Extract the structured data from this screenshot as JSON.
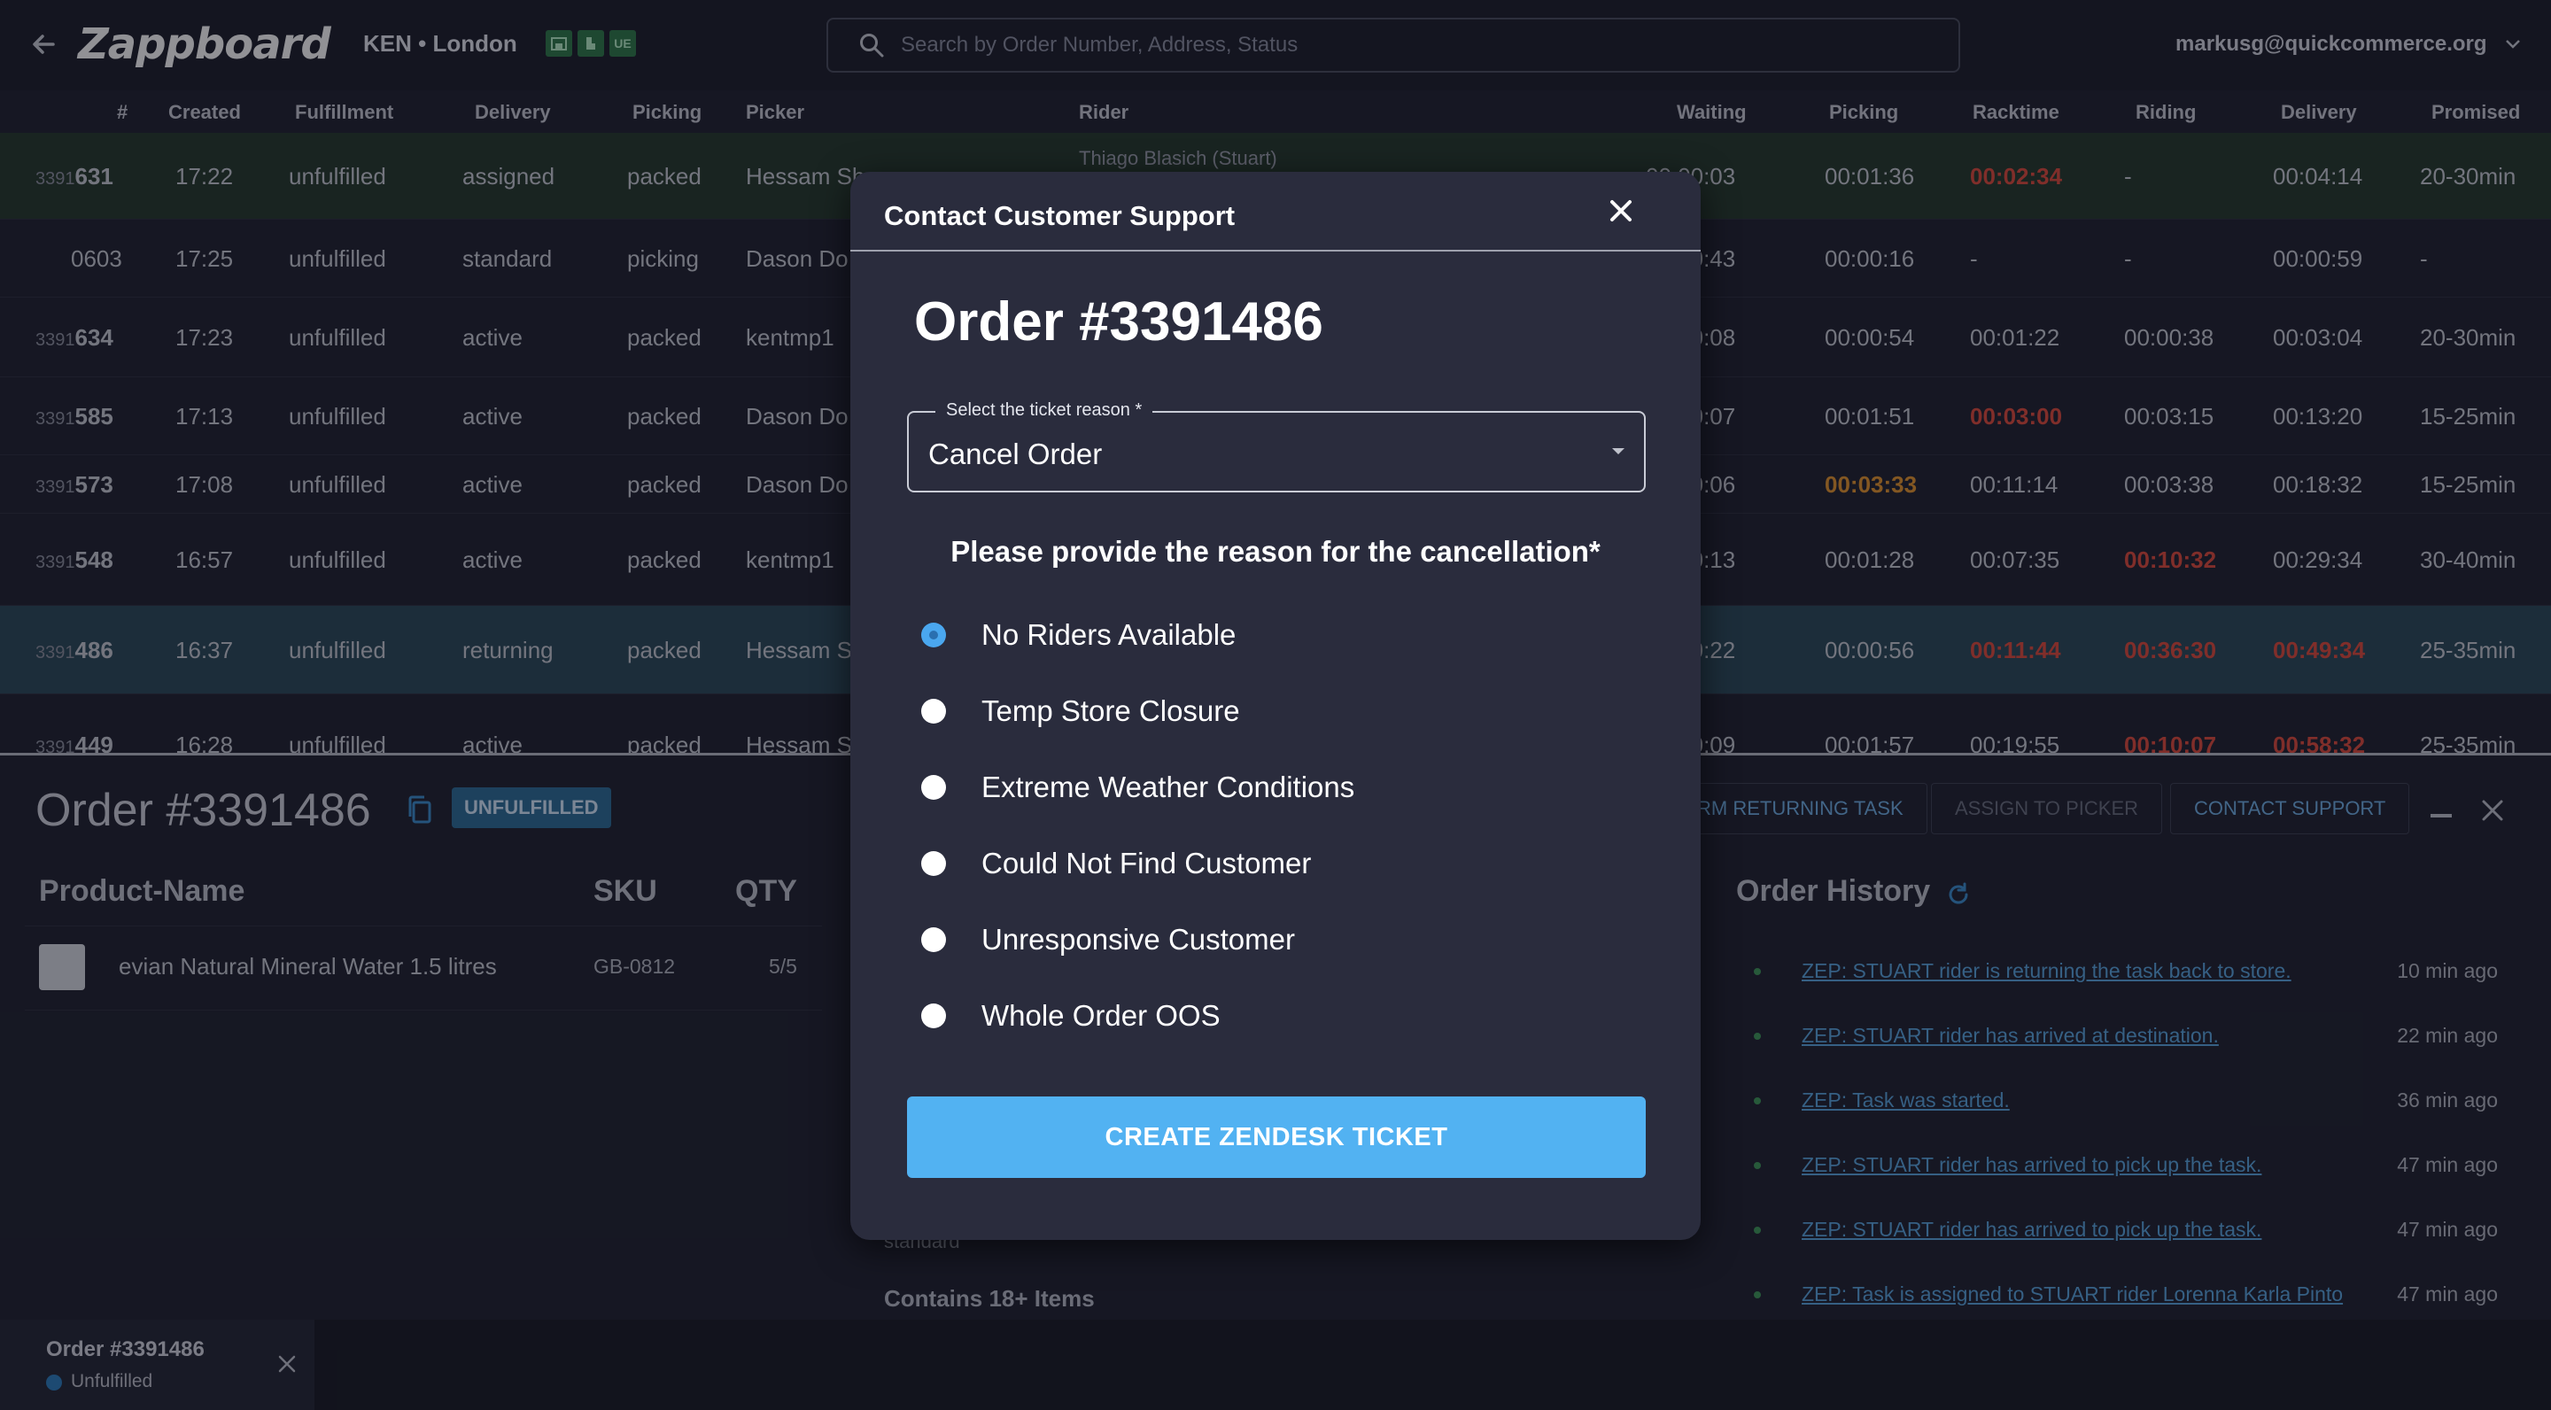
{
  "topbar": {
    "logo": "Zappboard",
    "store": "KEN • London",
    "badges": [
      "",
      "",
      "UE"
    ],
    "search_placeholder": "Search by Order Number, Address, Status",
    "user_email": "markusg@quickcommerce.org"
  },
  "table": {
    "headers": {
      "num": "#",
      "created": "Created",
      "fulfillment": "Fulfillment",
      "delivery": "Delivery",
      "picking": "Picking",
      "picker": "Picker",
      "rider": "Rider",
      "waiting": "Waiting",
      "picking_time": "Picking",
      "racktime": "Racktime",
      "riding": "Riding",
      "delivery_time": "Delivery",
      "promised": "Promised"
    },
    "rows": [
      {
        "prefix": "3391",
        "num": "631",
        "created": "17:22",
        "fulfillment": "unfulfilled",
        "delivery": "assigned",
        "picking": "packed",
        "picker": "Hessam Sh",
        "rider": "Thiago Blasich (Stuart)",
        "waiting": "00:00:03",
        "picking_time": "00:01:36",
        "racktime": "00:02:34",
        "riding": "-",
        "delivery_time": "00:04:14",
        "promised": "20-30min"
      },
      {
        "prefix": "",
        "num": "0603",
        "created": "17:25",
        "fulfillment": "unfulfilled",
        "delivery": "standard",
        "picking": "picking",
        "picker": "Dason Do",
        "rider": "",
        "waiting": "00:00:43",
        "picking_time": "00:00:16",
        "racktime": "-",
        "riding": "-",
        "delivery_time": "00:00:59",
        "promised": "-"
      },
      {
        "prefix": "3391",
        "num": "634",
        "created": "17:23",
        "fulfillment": "unfulfilled",
        "delivery": "active",
        "picking": "packed",
        "picker": "kentmp1",
        "rider": "",
        "waiting": "00:00:08",
        "picking_time": "00:00:54",
        "racktime": "00:01:22",
        "riding": "00:00:38",
        "delivery_time": "00:03:04",
        "promised": "20-30min"
      },
      {
        "prefix": "3391",
        "num": "585",
        "created": "17:13",
        "fulfillment": "unfulfilled",
        "delivery": "active",
        "picking": "packed",
        "picker": "Dason Do",
        "rider": "",
        "waiting": "00:00:07",
        "picking_time": "00:01:51",
        "racktime": "00:03:00",
        "riding": "00:03:15",
        "delivery_time": "00:13:20",
        "promised": "15-25min"
      },
      {
        "prefix": "3391",
        "num": "573",
        "created": "17:08",
        "fulfillment": "unfulfilled",
        "delivery": "active",
        "picking": "packed",
        "picker": "Dason Do",
        "rider": "",
        "waiting": "00:00:06",
        "picking_time": "00:03:33",
        "racktime": "00:11:14",
        "riding": "00:03:38",
        "delivery_time": "00:18:32",
        "promised": "15-25min"
      },
      {
        "prefix": "3391",
        "num": "548",
        "created": "16:57",
        "fulfillment": "unfulfilled",
        "delivery": "active",
        "picking": "packed",
        "picker": "kentmp1",
        "rider": "",
        "waiting": "00:00:13",
        "picking_time": "00:01:28",
        "racktime": "00:07:35",
        "riding": "00:10:32",
        "delivery_time": "00:29:34",
        "promised": "30-40min"
      },
      {
        "prefix": "3391",
        "num": "486",
        "created": "16:37",
        "fulfillment": "unfulfilled",
        "delivery": "returning",
        "picking": "packed",
        "picker": "Hessam S",
        "rider": "",
        "waiting": "00:00:22",
        "picking_time": "00:00:56",
        "racktime": "00:11:44",
        "riding": "00:36:30",
        "delivery_time": "00:49:34",
        "promised": "25-35min"
      },
      {
        "prefix": "3391",
        "num": "449",
        "created": "16:28",
        "fulfillment": "unfulfilled",
        "delivery": "active",
        "picking": "packed",
        "picker": "Hessam S",
        "rider": "",
        "waiting": "00:00:09",
        "picking_time": "00:01:57",
        "racktime": "00:19:55",
        "riding": "00:10:07",
        "delivery_time": "00:58:32",
        "promised": "25-35min"
      }
    ]
  },
  "detail": {
    "title": "Order #3391486",
    "status": "UNFULFILLED",
    "actions": {
      "returning": "RM RETURNING TASK",
      "assign": "ASSIGN TO PICKER",
      "contact": "CONTACT SUPPORT"
    },
    "products_headers": {
      "name": "Product-Name",
      "sku": "SKU",
      "qty": "QTY"
    },
    "product": {
      "name": "evian Natural Mineral Water 1.5 litres",
      "sku": "GB-0812",
      "qty": "5/5"
    },
    "behind": {
      "standard": "standard",
      "contains": "Contains 18+ Items"
    },
    "history_title": "Order History",
    "history": [
      {
        "text": "ZEP: STUART rider is returning the task back to store.",
        "time": "10 min ago"
      },
      {
        "text": "ZEP: STUART rider has arrived at destination.",
        "time": "22 min ago"
      },
      {
        "text": "ZEP: Task was started.",
        "time": "36 min ago"
      },
      {
        "text": "ZEP: STUART rider has arrived to pick up the task.",
        "time": "47 min ago"
      },
      {
        "text": "ZEP: STUART rider has arrived to pick up the task.",
        "time": "47 min ago"
      },
      {
        "text": "ZEP: Task is assigned to STUART rider Lorenna Karla Pinto",
        "time": "47 min ago"
      }
    ]
  },
  "bottom_tab": {
    "title": "Order #3391486",
    "status": "Unfulfilled"
  },
  "modal": {
    "title": "Contact Customer Support",
    "order": "Order #3391486",
    "select_label": "Select the ticket reason *",
    "select_value": "Cancel Order",
    "question": "Please provide the reason for the cancellation*",
    "options": [
      {
        "label": "No Riders Available",
        "checked": true
      },
      {
        "label": "Temp Store Closure",
        "checked": false
      },
      {
        "label": "Extreme Weather Conditions",
        "checked": false
      },
      {
        "label": "Could Not Find Customer",
        "checked": false
      },
      {
        "label": "Unresponsive Customer",
        "checked": false
      },
      {
        "label": "Whole Order OOS",
        "checked": false
      }
    ],
    "submit": "CREATE ZENDESK TICKET"
  },
  "colors": {
    "accent": "#52b2f2",
    "danger": "#e04b3c",
    "warning": "#e6962e",
    "active_row": "#2b4a5a",
    "assigned_row": "#263a2d"
  }
}
